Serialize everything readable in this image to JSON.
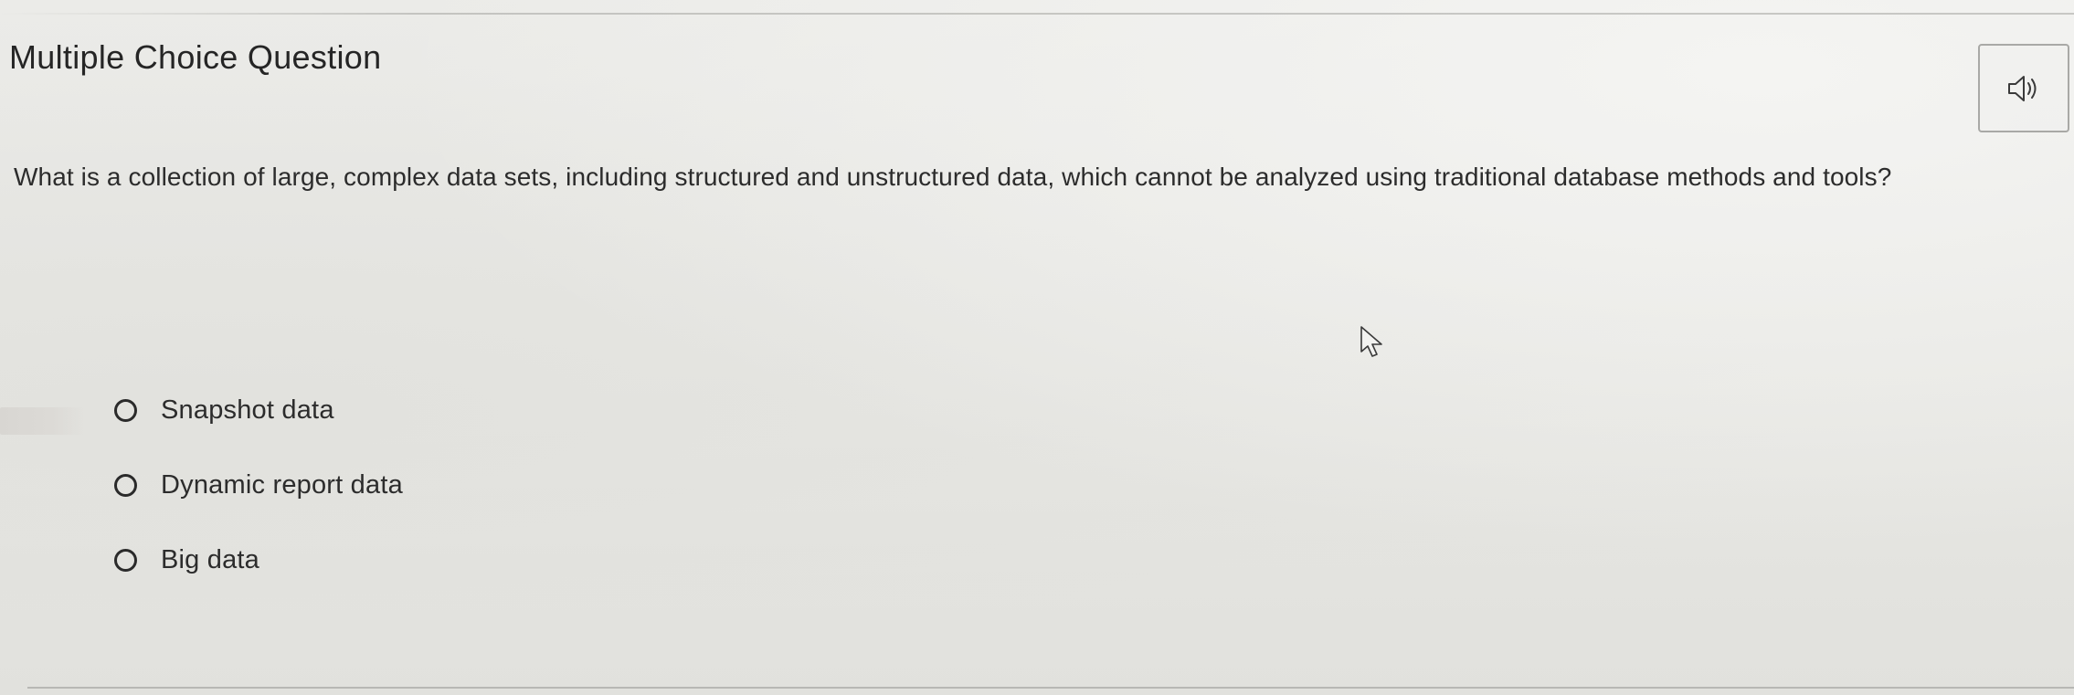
{
  "header": {
    "title": "Multiple Choice Question"
  },
  "audio": {
    "icon": "speaker-icon"
  },
  "question": {
    "text": "What is a collection of large, complex data sets, including structured and unstructured data, which cannot be analyzed using traditional database methods and tools?"
  },
  "options": [
    {
      "label": "Snapshot data",
      "selected": false
    },
    {
      "label": "Dynamic report data",
      "selected": false
    },
    {
      "label": "Big data",
      "selected": false
    }
  ],
  "colors": {
    "background": "#e8e8e5",
    "text": "#2c2c2c",
    "border": "#a9a9a6"
  }
}
